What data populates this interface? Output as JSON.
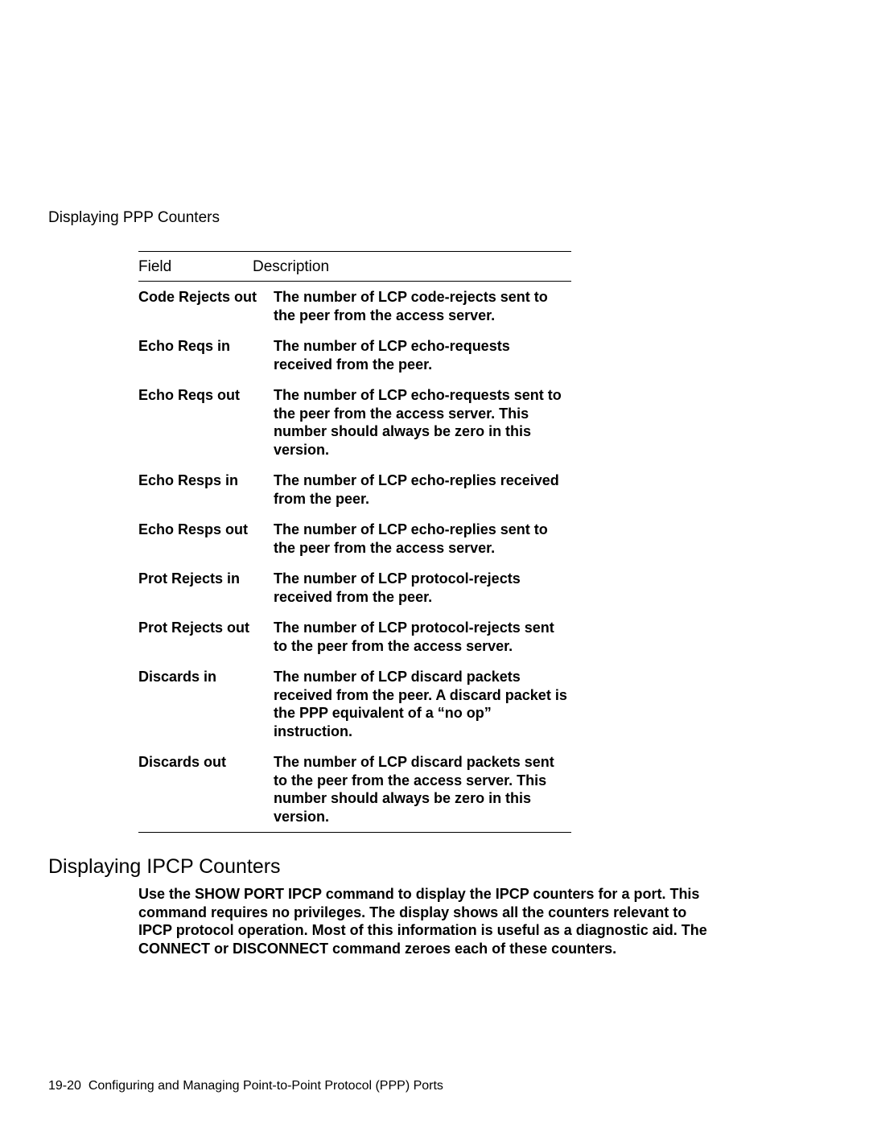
{
  "header": "Displaying PPP Counters",
  "table": {
    "head_field": "Field",
    "head_desc": "Description",
    "rows": [
      {
        "field": "Code Rejects out",
        "desc": "The number of LCP code-rejects sent to the peer from the access server."
      },
      {
        "field": "Echo Reqs in",
        "desc": "The number of LCP echo-requests received from the peer."
      },
      {
        "field": "Echo Reqs out",
        "desc": "The number of LCP echo-requests sent to the peer from the access server. This number should always be zero in this version."
      },
      {
        "field": "Echo Resps in",
        "desc": "The number of LCP echo-replies received from the peer."
      },
      {
        "field": "Echo Resps out",
        "desc": "The number of LCP echo-replies sent to the peer from the access server."
      },
      {
        "field": "Prot Rejects in",
        "desc": "The number of LCP protocol-rejects received from the peer."
      },
      {
        "field": "Prot Rejects out",
        "desc": "The number of LCP protocol-rejects sent to the peer from the access server."
      },
      {
        "field": "Discards in",
        "desc": "The number of LCP discard packets received from the peer. A discard packet is the PPP equivalent of a “no op” instruction."
      },
      {
        "field": "Discards out",
        "desc": "The number of LCP discard packets sent to the peer from the access server. This number should always be zero in this version."
      }
    ]
  },
  "section_heading": "Displaying IPCP Counters",
  "body_para": "Use the SHOW PORT IPCP command to display the IPCP counters for a port. This command requires no privileges. The display shows all the counters relevant to IPCP protocol operation. Most of this information is useful as a diagnostic aid. The CONNECT or DISCONNECT command zeroes each of these counters.",
  "footer": "19-20  Configuring and Managing Point-to-Point Protocol (PPP) Ports"
}
